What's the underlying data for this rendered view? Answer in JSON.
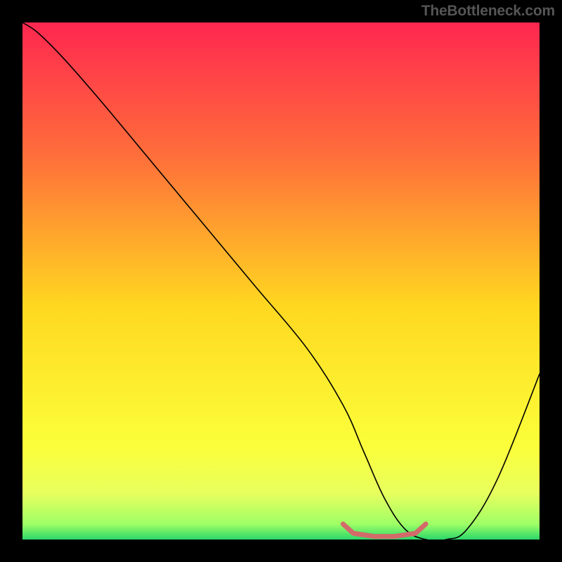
{
  "watermark": "TheBottleneck.com",
  "chart_data": {
    "type": "line",
    "title": "",
    "xlabel": "",
    "ylabel": "",
    "xlim": [
      0,
      100
    ],
    "ylim": [
      0,
      100
    ],
    "series": [
      {
        "name": "bottleneck-curve",
        "x": [
          0,
          3,
          8,
          15,
          25,
          35,
          45,
          55,
          62,
          66,
          70,
          74,
          78,
          82,
          86,
          92,
          100
        ],
        "y": [
          100,
          98,
          93,
          85,
          73,
          61,
          49,
          37,
          26,
          17,
          8,
          2,
          0,
          0,
          2,
          12,
          32
        ],
        "color": "#000000",
        "width": 1.6
      },
      {
        "name": "optimal-range-marker",
        "x": [
          62,
          64,
          68,
          72,
          76,
          78
        ],
        "y": [
          3,
          1.2,
          0.6,
          0.6,
          1.2,
          3
        ],
        "color": "#d36a6a",
        "width": 7
      }
    ],
    "background_gradient": {
      "stops": [
        {
          "offset": 0.0,
          "color": "#ff2750"
        },
        {
          "offset": 0.26,
          "color": "#ff6f3a"
        },
        {
          "offset": 0.55,
          "color": "#ffd820"
        },
        {
          "offset": 0.82,
          "color": "#fbff3a"
        },
        {
          "offset": 0.91,
          "color": "#e8ff5e"
        },
        {
          "offset": 0.97,
          "color": "#9fff66"
        },
        {
          "offset": 1.0,
          "color": "#2bd86a"
        }
      ]
    }
  }
}
